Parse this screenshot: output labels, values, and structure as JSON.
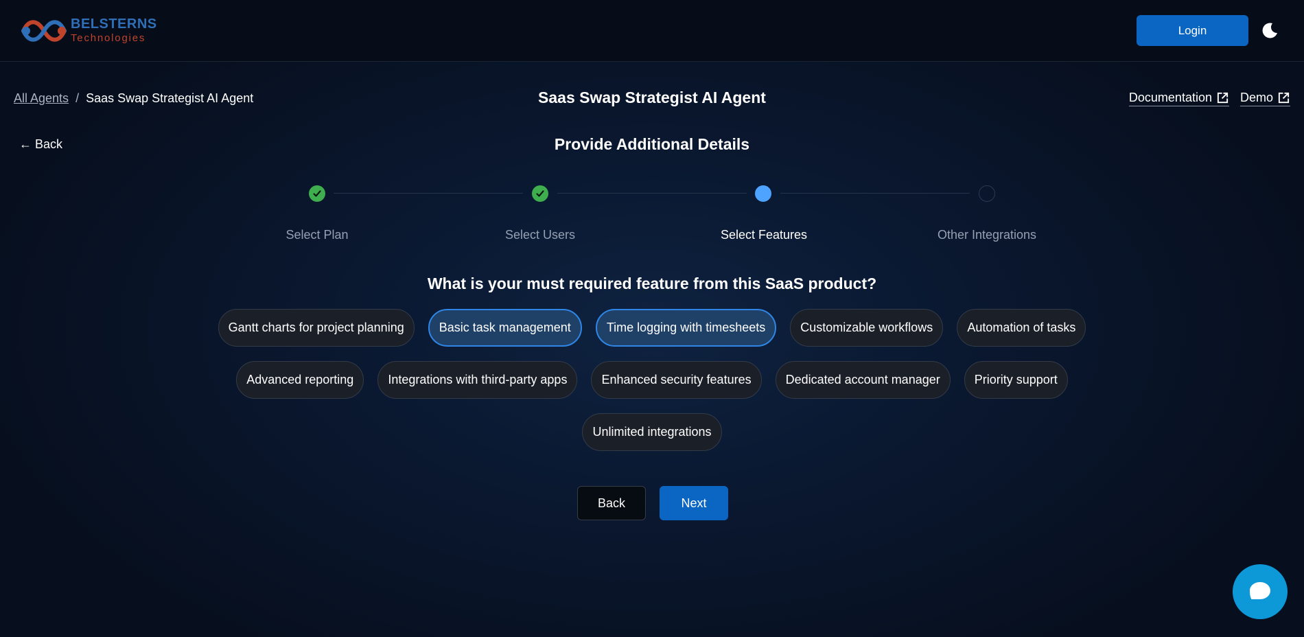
{
  "header": {
    "logo_line1": "BELSTERNS",
    "logo_line2": "Technologies",
    "login_label": "Login"
  },
  "breadcrumb": {
    "root": "All Agents",
    "separator": "/",
    "current": "Saas Swap Strategist AI Agent"
  },
  "page_title": "Saas Swap Strategist AI Agent",
  "links": {
    "documentation": "Documentation",
    "demo": "Demo"
  },
  "back_link": "← Back",
  "section_title": "Provide Additional Details",
  "steps": [
    {
      "label": "Select Plan",
      "status": "done"
    },
    {
      "label": "Select Users",
      "status": "done"
    },
    {
      "label": "Select Features",
      "status": "active"
    },
    {
      "label": "Other Integrations",
      "status": "pending"
    }
  ],
  "question": "What is your must required feature from this SaaS product?",
  "options": [
    {
      "label": "Gantt charts for project planning",
      "selected": false
    },
    {
      "label": "Basic task management",
      "selected": true
    },
    {
      "label": "Time logging with timesheets",
      "selected": true
    },
    {
      "label": "Customizable workflows",
      "selected": false
    },
    {
      "label": "Automation of tasks",
      "selected": false
    },
    {
      "label": "Advanced reporting",
      "selected": false
    },
    {
      "label": "Integrations with third-party apps",
      "selected": false
    },
    {
      "label": "Enhanced security features",
      "selected": false
    },
    {
      "label": "Dedicated account manager",
      "selected": false
    },
    {
      "label": "Priority support",
      "selected": false
    },
    {
      "label": "Unlimited integrations",
      "selected": false
    }
  ],
  "actions": {
    "back": "Back",
    "next": "Next"
  },
  "colors": {
    "accent": "#0a66c2",
    "step_done": "#3fae4f",
    "step_active": "#4da3ff",
    "chip_selected_border": "#2f86e6",
    "chat_button": "#0d99d8"
  }
}
